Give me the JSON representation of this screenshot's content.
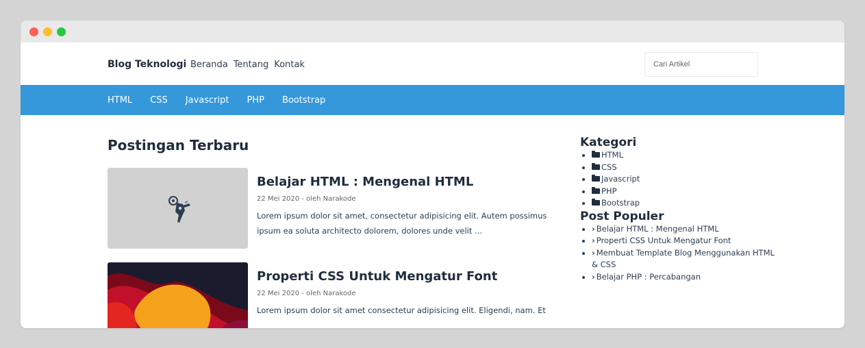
{
  "brand": "Blog Teknologi",
  "menu": [
    "Beranda",
    "Tentang",
    "Kontak"
  ],
  "search": {
    "placeholder": "Cari Artikel"
  },
  "categories_bar": [
    "HTML",
    "CSS",
    "Javascript",
    "PHP",
    "Bootstrap"
  ],
  "main": {
    "heading": "Postingan Terbaru",
    "posts": [
      {
        "title": "Belajar HTML : Mengenal HTML",
        "meta": "22 Mei 2020 - oleh Narakode",
        "excerpt": "Lorem ipsum dolor sit amet, consectetur adipisicing elit. Autem possimus ipsum ea soluta architecto dolorem, dolores unde velit ..."
      },
      {
        "title": "Properti CSS Untuk Mengatur Font",
        "meta": "22 Mei 2020 - oleh Narakode",
        "excerpt": "Lorem ipsum dolor sit amet consectetur adipisicing elit. Eligendi, nam. Et"
      }
    ]
  },
  "sidebar": {
    "categories_title": "Kategori",
    "categories": [
      "HTML",
      "CSS",
      "Javascript",
      "PHP",
      "Bootstrap"
    ],
    "popular_title": "Post Populer",
    "popular": [
      "Belajar HTML : Mengenal HTML",
      "Properti CSS Untuk Mengatur Font",
      "Membuat Template Blog Menggunakan HTML & CSS",
      "Belajar PHP : Percabangan"
    ]
  },
  "colors": {
    "accent": "#3498db",
    "text": "#2c3e50"
  }
}
